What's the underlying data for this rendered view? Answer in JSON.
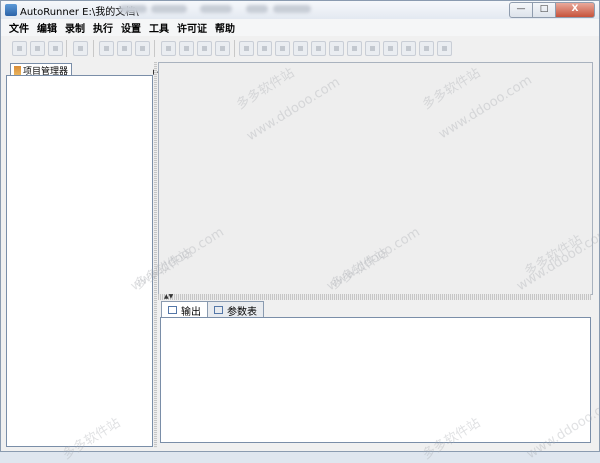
{
  "window": {
    "title": "AutoRunner  E:\\我的文档\\",
    "buttons": {
      "minimize": "—",
      "maximize": "□",
      "close": "X"
    }
  },
  "menu": [
    "文件",
    "编辑",
    "录制",
    "执行",
    "设置",
    "工具",
    "许可证",
    "帮助"
  ],
  "left_panel": {
    "tab_label": "项目管理器"
  },
  "output_panel": {
    "tabs": [
      "输出",
      "参数表"
    ]
  },
  "watermarks": [
    "多多软件站",
    "www.ddooo.com"
  ]
}
